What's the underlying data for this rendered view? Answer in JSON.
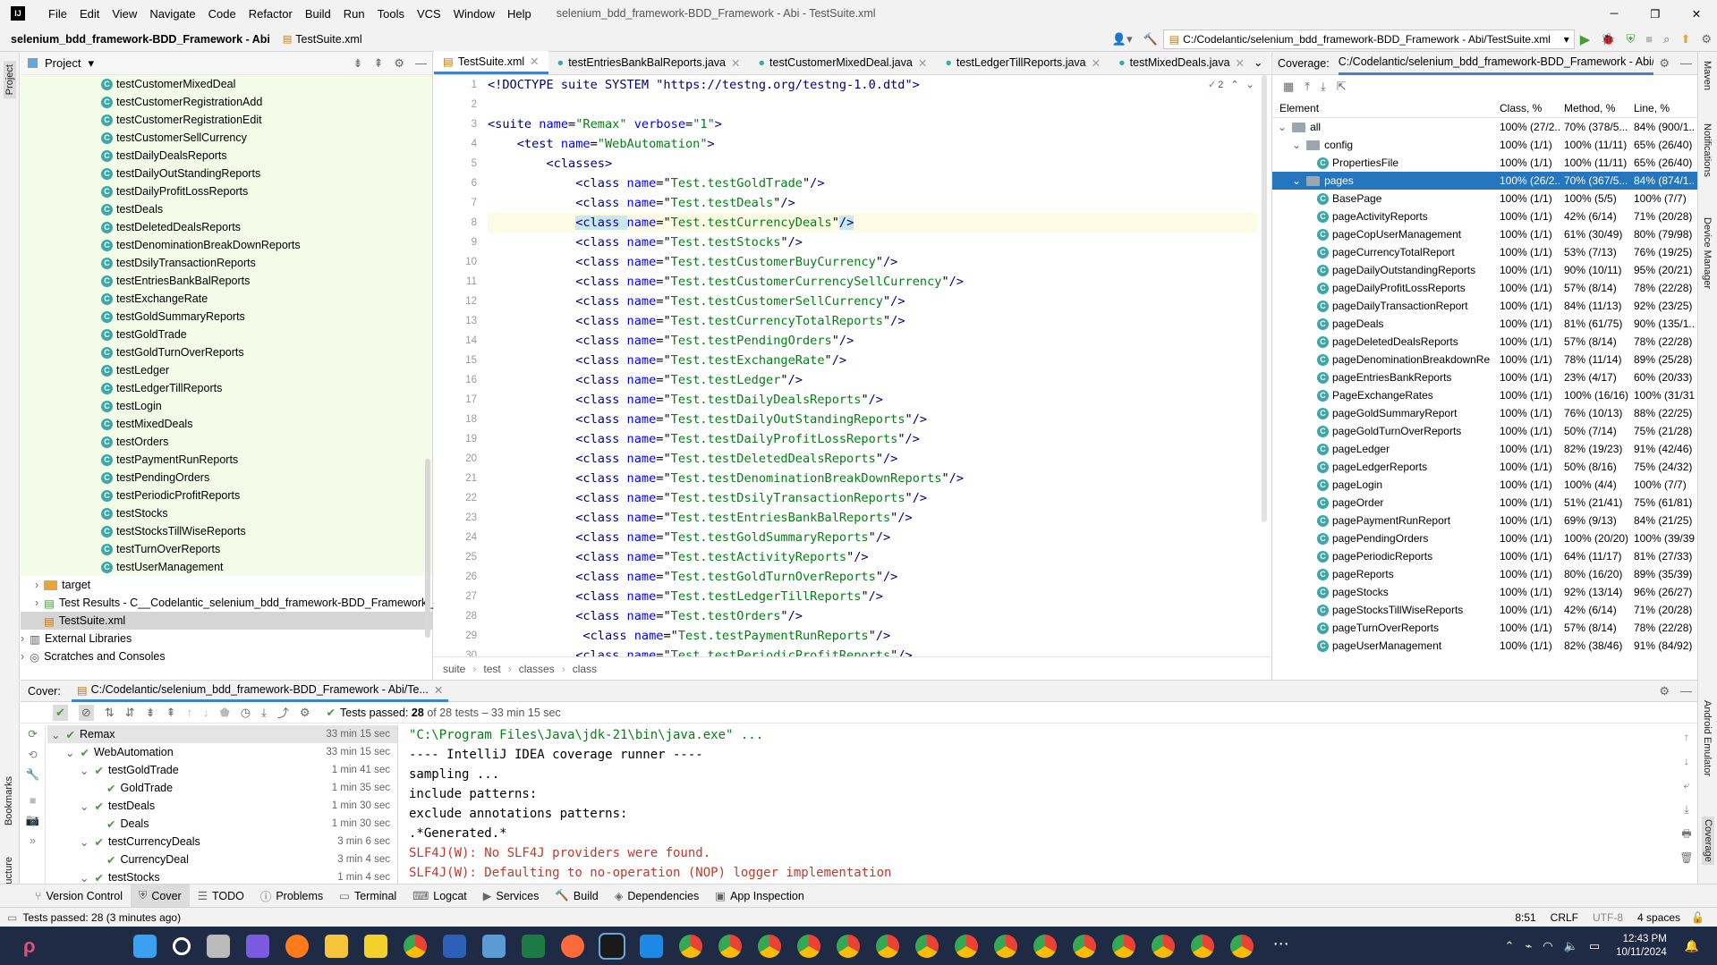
{
  "menu": [
    "File",
    "Edit",
    "View",
    "Navigate",
    "Code",
    "Refactor",
    "Build",
    "Run",
    "Tools",
    "VCS",
    "Window",
    "Help"
  ],
  "window_title": "selenium_bdd_framework-BDD_Framework - Abi - TestSuite.xml",
  "nav": {
    "project": "selenium_bdd_framework-BDD_Framework - Abi",
    "file": "TestSuite.xml",
    "run_config": "C:/Codelantic/selenium_bdd_framework-BDD_Framework - Abi/TestSuite.xml"
  },
  "project_panel": {
    "title": "Project",
    "files": [
      "testCustomerMixedDeal",
      "testCustomerRegistrationAdd",
      "testCustomerRegistrationEdit",
      "testCustomerSellCurrency",
      "testDailyDealsReports",
      "testDailyOutStandingReports",
      "testDailyProfitLossReports",
      "testDeals",
      "testDeletedDealsReports",
      "testDenominationBreakDownReports",
      "testDsilyTransactionReports",
      "testEntriesBankBalReports",
      "testExchangeRate",
      "testGoldSummaryReports",
      "testGoldTrade",
      "testGoldTurnOverReports",
      "testLedger",
      "testLedgerTillReports",
      "testLogin",
      "testMixedDeals",
      "testOrders",
      "testPaymentRunReports",
      "testPendingOrders",
      "testPeriodicProfitReports",
      "testStocks",
      "testStocksTillWiseReports",
      "testTurnOverReports",
      "testUserManagement"
    ],
    "target": "target",
    "test_results": "Test Results - C__Codelantic_selenium_bdd_framework-BDD_Framework_-_A",
    "testsuite": "TestSuite.xml",
    "external": "External Libraries",
    "scratches": "Scratches and Consoles"
  },
  "editor": {
    "tabs": [
      "TestSuite.xml",
      "testEntriesBankBalReports.java",
      "testCustomerMixedDeal.java",
      "testLedgerTillReports.java",
      "testMixedDeals.java"
    ],
    "inspection_count": "2",
    "doctype": "<!DOCTYPE suite SYSTEM \"https://testng.org/testng-1.0.dtd\">",
    "suite_name": "\"Remax\"",
    "suite_verbose": "\"1\"",
    "test_name": "\"WebAutomation\"",
    "classes": [
      "Test.testGoldTrade",
      "Test.testDeals",
      "Test.testCurrencyDeals",
      "Test.testStocks",
      "Test.testCustomerBuyCurrency",
      "Test.testCustomerCurrencySellCurrency",
      "Test.testCustomerSellCurrency",
      "Test.testCurrencyTotalReports",
      "Test.testPendingOrders",
      "Test.testExchangeRate",
      "Test.testLedger",
      "Test.testDailyDealsReports",
      "Test.testDailyOutStandingReports",
      "Test.testDailyProfitLossReports",
      "Test.testDeletedDealsReports",
      "Test.testDenominationBreakDownReports",
      "Test.testDsilyTransactionReports",
      "Test.testEntriesBankBalReports",
      "Test.testGoldSummaryReports",
      "Test.testActivityReports",
      "Test.testGoldTurnOverReports",
      "Test.testLedgerTillReports",
      "Test.testOrders",
      "Test.testPaymentRunReports",
      "Test.testPeriodicProfitReports"
    ],
    "breadcrumbs": [
      "suite",
      "test",
      "classes",
      "class"
    ]
  },
  "coverage": {
    "label": "Coverage:",
    "path": "C:/Codelantic/selenium_bdd_framework-BDD_Framework - Abi/Te",
    "headers": [
      "Element",
      "Class, %",
      "Method, %",
      "Line, %"
    ],
    "rows": [
      {
        "name": "all",
        "cls": "100% (27/2...",
        "meth": "70% (378/5...",
        "line": "84% (900/1..."
      },
      {
        "name": "config",
        "cls": "100% (1/1)",
        "meth": "100% (11/11)",
        "line": "65% (26/40)"
      },
      {
        "name": "PropertiesFile",
        "cls": "100% (1/1)",
        "meth": "100% (11/11)",
        "line": "65% (26/40)"
      },
      {
        "name": "pages",
        "cls": "100% (26/2...",
        "meth": "70% (367/5...",
        "line": "84% (874/1..."
      },
      {
        "name": "BasePage",
        "cls": "100% (1/1)",
        "meth": "100% (5/5)",
        "line": "100% (7/7)"
      },
      {
        "name": "pageActivityReports",
        "cls": "100% (1/1)",
        "meth": "42% (6/14)",
        "line": "71% (20/28)"
      },
      {
        "name": "pageCopUserManagement",
        "cls": "100% (1/1)",
        "meth": "61% (30/49)",
        "line": "80% (79/98)"
      },
      {
        "name": "pageCurrencyTotalReport",
        "cls": "100% (1/1)",
        "meth": "53% (7/13)",
        "line": "76% (19/25)"
      },
      {
        "name": "pageDailyOutstandingReports",
        "cls": "100% (1/1)",
        "meth": "90% (10/11)",
        "line": "95% (20/21)"
      },
      {
        "name": "pageDailyProfitLossReports",
        "cls": "100% (1/1)",
        "meth": "57% (8/14)",
        "line": "78% (22/28)"
      },
      {
        "name": "pageDailyTransactionReport",
        "cls": "100% (1/1)",
        "meth": "84% (11/13)",
        "line": "92% (23/25)"
      },
      {
        "name": "pageDeals",
        "cls": "100% (1/1)",
        "meth": "81% (61/75)",
        "line": "90% (135/1..."
      },
      {
        "name": "pageDeletedDealsReports",
        "cls": "100% (1/1)",
        "meth": "57% (8/14)",
        "line": "78% (22/28)"
      },
      {
        "name": "pageDenominationBreakdownRe",
        "cls": "100% (1/1)",
        "meth": "78% (11/14)",
        "line": "89% (25/28)"
      },
      {
        "name": "pageEntriesBankReports",
        "cls": "100% (1/1)",
        "meth": "23% (4/17)",
        "line": "60% (20/33)"
      },
      {
        "name": "PageExchangeRates",
        "cls": "100% (1/1)",
        "meth": "100% (16/16)",
        "line": "100% (31/31)"
      },
      {
        "name": "pageGoldSummaryReport",
        "cls": "100% (1/1)",
        "meth": "76% (10/13)",
        "line": "88% (22/25)"
      },
      {
        "name": "pageGoldTurnOverReports",
        "cls": "100% (1/1)",
        "meth": "50% (7/14)",
        "line": "75% (21/28)"
      },
      {
        "name": "pageLedger",
        "cls": "100% (1/1)",
        "meth": "82% (19/23)",
        "line": "91% (42/46)"
      },
      {
        "name": "pageLedgerReports",
        "cls": "100% (1/1)",
        "meth": "50% (8/16)",
        "line": "75% (24/32)"
      },
      {
        "name": "pageLogin",
        "cls": "100% (1/1)",
        "meth": "100% (4/4)",
        "line": "100% (7/7)"
      },
      {
        "name": "pageOrder",
        "cls": "100% (1/1)",
        "meth": "51% (21/41)",
        "line": "75% (61/81)"
      },
      {
        "name": "pagePaymentRunReport",
        "cls": "100% (1/1)",
        "meth": "69% (9/13)",
        "line": "84% (21/25)"
      },
      {
        "name": "pagePendingOrders",
        "cls": "100% (1/1)",
        "meth": "100% (20/20)",
        "line": "100% (39/39)"
      },
      {
        "name": "pagePeriodicReports",
        "cls": "100% (1/1)",
        "meth": "64% (11/17)",
        "line": "81% (27/33)"
      },
      {
        "name": "pageReports",
        "cls": "100% (1/1)",
        "meth": "80% (16/20)",
        "line": "89% (35/39)"
      },
      {
        "name": "pageStocks",
        "cls": "100% (1/1)",
        "meth": "92% (13/14)",
        "line": "96% (26/27)"
      },
      {
        "name": "pageStocksTillWiseReports",
        "cls": "100% (1/1)",
        "meth": "42% (6/14)",
        "line": "71% (20/28)"
      },
      {
        "name": "pageTurnOverReports",
        "cls": "100% (1/1)",
        "meth": "57% (8/14)",
        "line": "78% (22/28)"
      },
      {
        "name": "pageUserManagement",
        "cls": "100% (1/1)",
        "meth": "82% (38/46)",
        "line": "91% (84/92)"
      }
    ]
  },
  "bottom": {
    "tab_label": "Cover:",
    "tab_path": "C:/Codelantic/selenium_bdd_framework-BDD_Framework - Abi/Te...",
    "status_prefix": "Tests passed:",
    "passed": "28",
    "status_suffix": "of 28 tests – 33 min 15 sec",
    "tree": [
      {
        "name": "Remax",
        "time": "33 min 15 sec"
      },
      {
        "name": "WebAutomation",
        "time": "33 min 15 sec"
      },
      {
        "name": "testGoldTrade",
        "time": "1 min 41 sec"
      },
      {
        "name": "GoldTrade",
        "time": "1 min 35 sec"
      },
      {
        "name": "testDeals",
        "time": "1 min 30 sec"
      },
      {
        "name": "Deals",
        "time": "1 min 30 sec"
      },
      {
        "name": "testCurrencyDeals",
        "time": "3 min 6 sec"
      },
      {
        "name": "CurrencyDeal",
        "time": "3 min 4 sec"
      },
      {
        "name": "testStocks",
        "time": "1 min 4 sec"
      }
    ],
    "console": [
      "\"C:\\Program Files\\Java\\jdk-21\\bin\\java.exe\" ...",
      "---- IntelliJ IDEA coverage runner ----",
      "sampling ...",
      "include patterns:",
      "exclude annotations patterns:",
      ".*Generated.*",
      "SLF4J(W): No SLF4J providers were found.",
      "SLF4J(W): Defaulting to no-operation (NOP) logger implementation"
    ]
  },
  "toolwindows": [
    "Version Control",
    "Cover",
    "TODO",
    "Problems",
    "Terminal",
    "Logcat",
    "Services",
    "Build",
    "Dependencies",
    "App Inspection"
  ],
  "status": {
    "message": "Tests passed: 28 (3 minutes ago)",
    "position": "8:51",
    "line_sep": "CRLF",
    "encoding": "UTF-8",
    "indent": "4 spaces"
  },
  "clock": {
    "time": "12:43 PM",
    "date": "10/11/2024"
  },
  "side_left": [
    "Project",
    "Bookmarks",
    "Structure"
  ],
  "side_right": [
    "Maven",
    "Notifications",
    "Device Manager",
    "Android Emulator",
    "Coverage"
  ]
}
